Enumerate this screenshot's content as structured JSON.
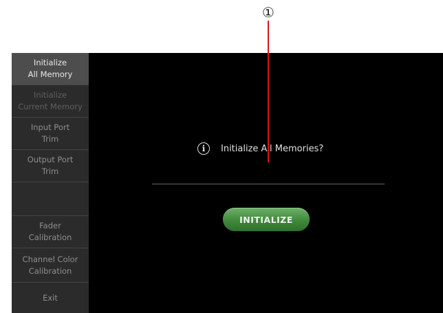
{
  "callout": {
    "number": "①"
  },
  "sidebar": {
    "items": [
      {
        "label": "Initialize\nAll Memory",
        "state": "active"
      },
      {
        "label": "Initialize\nCurrent Memory",
        "state": "disabled"
      },
      {
        "label": "Input Port\nTrim",
        "state": "normal"
      },
      {
        "label": "Output Port\nTrim",
        "state": "normal"
      },
      {
        "label": "",
        "state": "empty"
      },
      {
        "label": "Fader\nCalibration",
        "state": "normal"
      },
      {
        "label": "Channel Color\nCalibration",
        "state": "normal"
      },
      {
        "label": "Exit",
        "state": "normal"
      }
    ]
  },
  "dialog": {
    "icon": "info-icon",
    "message": "Initialize All Memories?",
    "button_label": "INITIALIZE"
  },
  "colors": {
    "screen_bg": "#000000",
    "sidebar_bg": "#2b2b2b",
    "button_green": "#3f8a3b",
    "leader_red": "#d9141e"
  }
}
